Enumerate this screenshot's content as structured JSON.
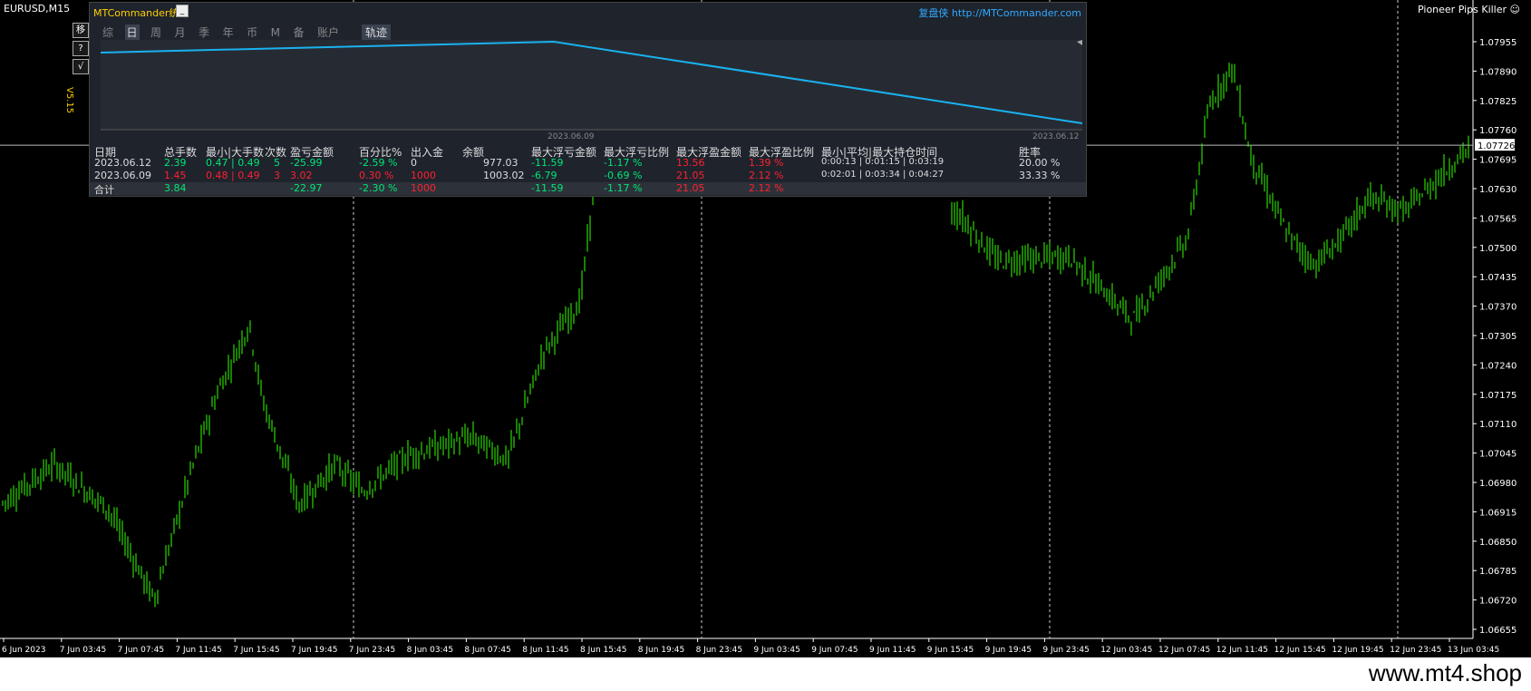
{
  "window": {
    "symbol": "EURUSD,M15",
    "ea_name": "Pioneer Pips Killer ☺",
    "version": "V5.15"
  },
  "side_buttons": [
    "移",
    "?",
    "√"
  ],
  "panel": {
    "title": "MTCommander统计",
    "link": "复盘侠 http://MTCommander.com",
    "tabs": [
      "综",
      "日",
      "周",
      "月",
      "季",
      "年",
      "币",
      "M",
      "备",
      "账户"
    ],
    "active_tab": "日",
    "track_label": "轨迹",
    "curve_dates": [
      "2023.06.09",
      "2023.06.12"
    ],
    "headers": [
      "日期",
      "总手数",
      "最小|大手数",
      "次数",
      "盈亏金额",
      "百分比%",
      "出入金",
      "余额",
      "最大浮亏金额",
      "最大浮亏比例",
      "最大浮盈金额",
      "最大浮盈比例",
      "最小|平均|最大持仓时间",
      "胜率"
    ],
    "rows": [
      [
        "2023.06.12",
        "2.39",
        "0.47 | 0.49",
        "5",
        "-25.99",
        "-2.59 %",
        "0",
        "977.03",
        "-11.59",
        "-1.17 %",
        "13.56",
        "1.39 %",
        "0:00:13 | 0:01:15 | 0:03:19",
        "20.00 %"
      ],
      [
        "2023.06.09",
        "1.45",
        "0.48 | 0.49",
        "3",
        "3.02",
        "0.30 %",
        "1000",
        "1003.02",
        "-6.79",
        "-0.69 %",
        "21.05",
        "2.12 %",
        "0:02:01 | 0:03:34 | 0:04:27",
        "33.33 %"
      ]
    ],
    "total": [
      "合计",
      "3.84",
      "",
      "",
      "-22.97",
      "-2.30 %",
      "1000",
      "",
      "-11.59",
      "-1.17 %",
      "21.05",
      "2.12 %",
      "",
      ""
    ]
  },
  "colors": {
    "candle": "#33ff00",
    "equity_curve": "#1ab2f0",
    "positive": "#00e676",
    "negative": "#ff2030",
    "axis": "#ffffff"
  },
  "price_axis": {
    "levels": [
      "1.07955",
      "1.07890",
      "1.07825",
      "1.07760",
      "1.07695",
      "1.07630",
      "1.07565",
      "1.07500",
      "1.07435",
      "1.07370",
      "1.07305",
      "1.07240",
      "1.07175",
      "1.07110",
      "1.07045",
      "1.06980",
      "1.06915",
      "1.06850",
      "1.06785",
      "1.06720",
      "1.06655"
    ],
    "current": "1.07726"
  },
  "time_axis": [
    "6 Jun 2023",
    "7 Jun 03:45",
    "7 Jun 07:45",
    "7 Jun 11:45",
    "7 Jun 15:45",
    "7 Jun 19:45",
    "7 Jun 23:45",
    "8 Jun 03:45",
    "8 Jun 07:45",
    "8 Jun 11:45",
    "8 Jun 15:45",
    "8 Jun 19:45",
    "8 Jun 23:45",
    "9 Jun 03:45",
    "9 Jun 07:45",
    "9 Jun 11:45",
    "9 Jun 15:45",
    "9 Jun 19:45",
    "9 Jun 23:45",
    "12 Jun 03:45",
    "12 Jun 07:45",
    "12 Jun 11:45",
    "12 Jun 15:45",
    "12 Jun 19:45",
    "12 Jun 23:45",
    "13 Jun 03:45"
  ],
  "watermark": "www.mt4.shop"
}
